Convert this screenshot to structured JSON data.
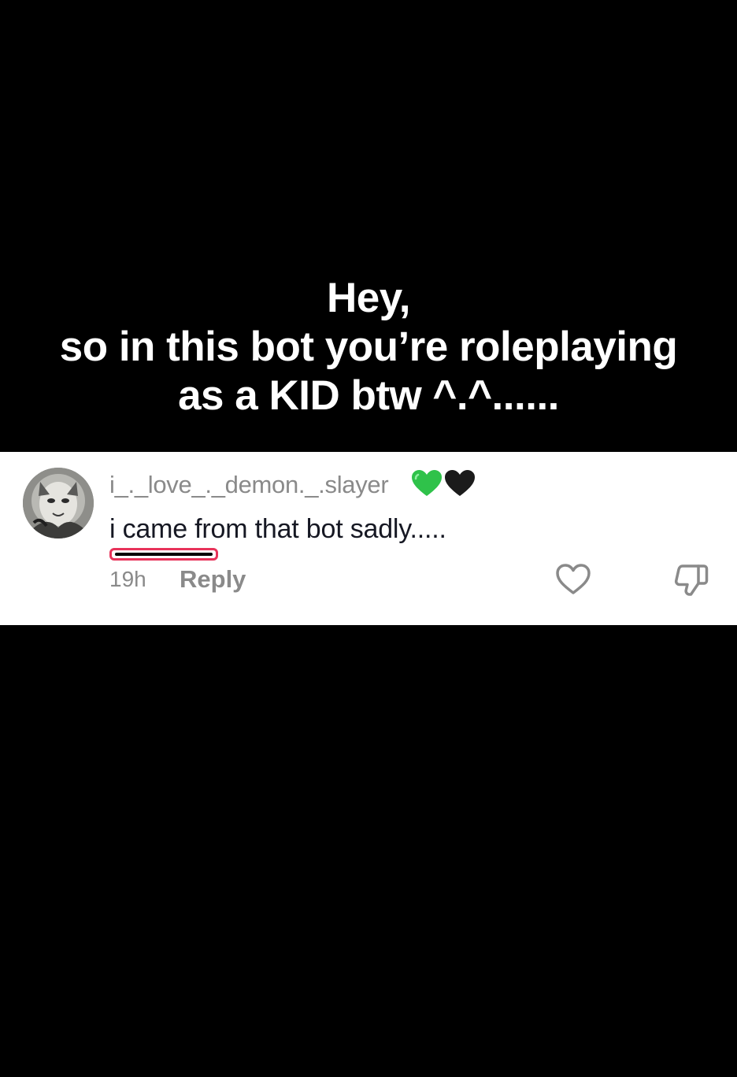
{
  "overlay": {
    "caption_lines": [
      "Hey,",
      "so in this bot you’re roleplaying",
      "as a KID btw ^.^......"
    ]
  },
  "comment": {
    "username": "i_._love_._demon._.slayer",
    "username_badges": [
      "green-heart-icon",
      "black-heart-icon"
    ],
    "text": "i came from that bot sadly.....",
    "timestamp": "19h",
    "reply_label": "Reply",
    "colors": {
      "card_background": "#ffffff",
      "muted_text": "#8a8a8a",
      "body_text": "#161823",
      "highlight_outline": "#e8335a",
      "green_heart": "#2fc24a",
      "black_heart": "#1b1b1b"
    }
  },
  "icons": {
    "like": "heart-outline-icon",
    "dislike": "thumbs-down-icon",
    "avatar": "avatar-image"
  }
}
